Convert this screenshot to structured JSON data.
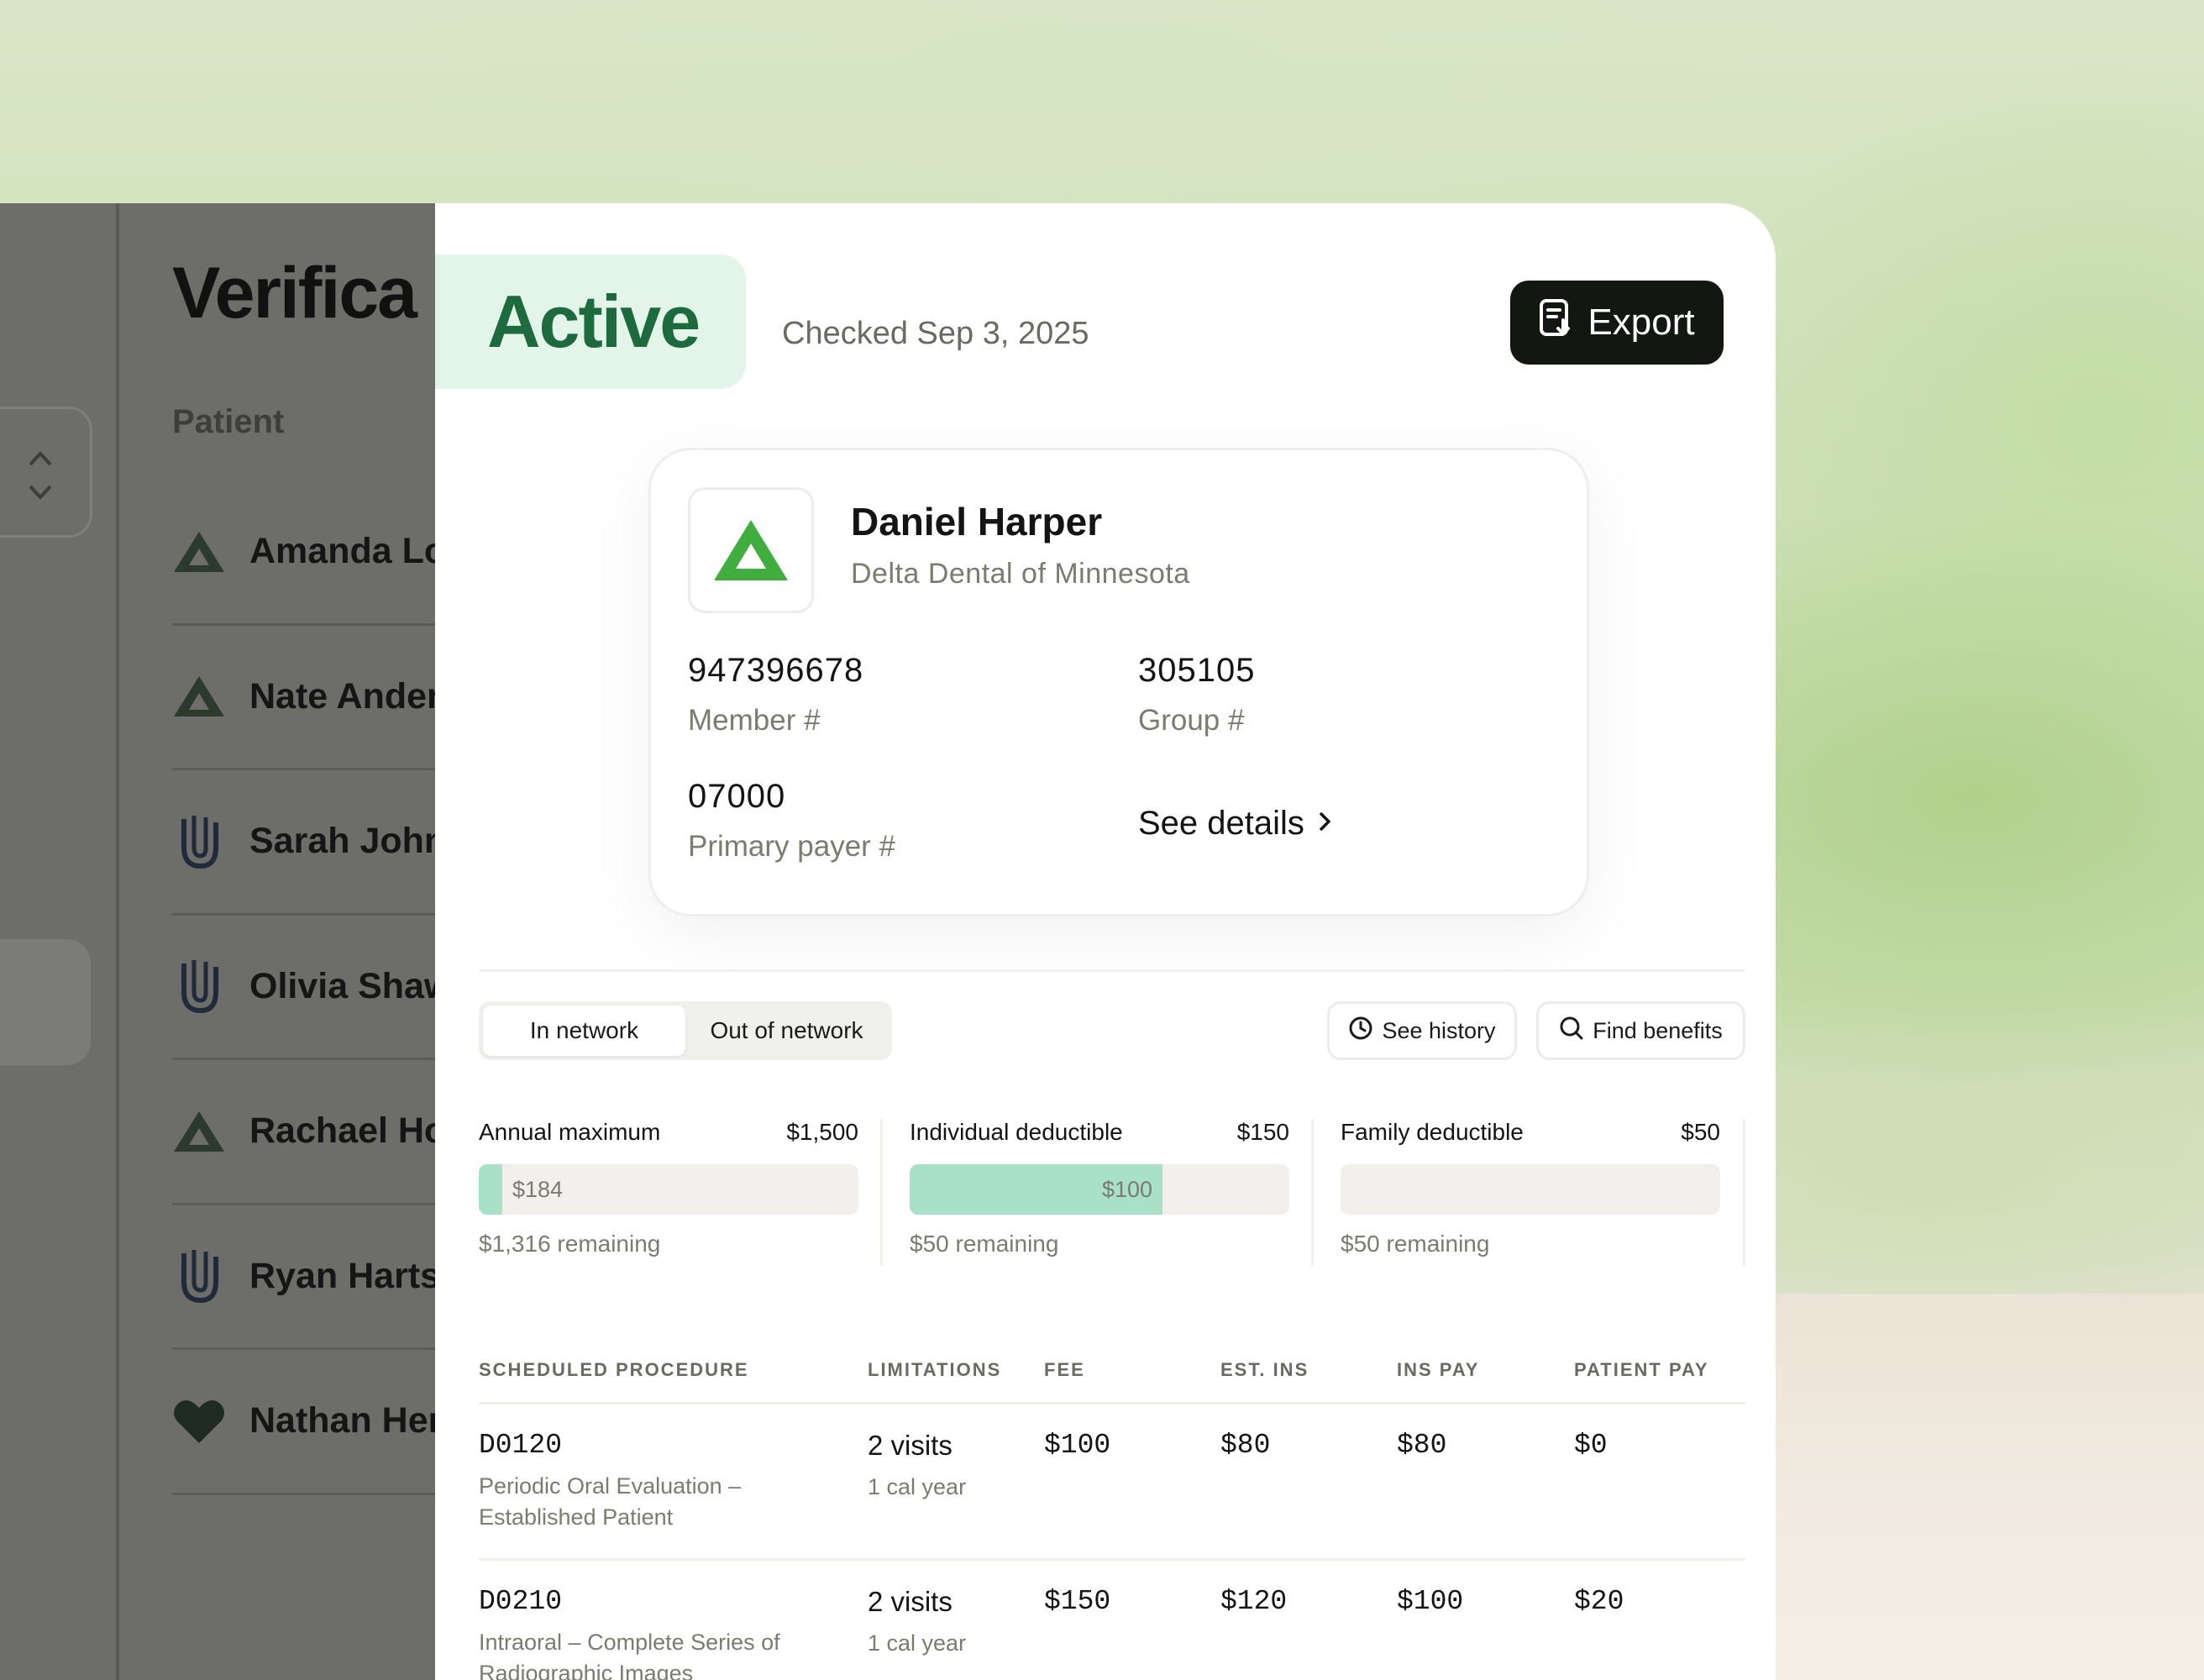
{
  "sidebar": {
    "title": "Verifica",
    "section_label": "Patient",
    "patients": [
      {
        "name": "Amanda Lo",
        "logo": "delta-dental-icon"
      },
      {
        "name": "Nate Ander",
        "logo": "delta-dental-icon"
      },
      {
        "name": "Sarah John",
        "logo": "unitedhealthcare-icon"
      },
      {
        "name": "Olivia Shaw",
        "logo": "unitedhealthcare-icon"
      },
      {
        "name": "Rachael Ho",
        "logo": "delta-dental-icon"
      },
      {
        "name": "Ryan Harts",
        "logo": "unitedhealthcare-icon"
      },
      {
        "name": "Nathan Her",
        "logo": "heart-icon"
      }
    ]
  },
  "header": {
    "status": "Active",
    "checked": "Checked Sep 3, 2025",
    "export_label": "Export"
  },
  "member_card": {
    "name": "Daniel Harper",
    "payer": "Delta Dental of Minnesota",
    "member_number": "947396678",
    "member_label": "Member #",
    "group_number": "305105",
    "group_label": "Group #",
    "primary_payer_number": "07000",
    "primary_payer_label": "Primary payer #",
    "details_link": "See details"
  },
  "network_tabs": [
    {
      "label": "In network",
      "active": true
    },
    {
      "label": "Out of network",
      "active": false
    }
  ],
  "actions": {
    "history_label": "See history",
    "benefits_label": "Find benefits"
  },
  "meters": [
    {
      "title": "Annual maximum",
      "max": "$1,500",
      "used": "$184",
      "used_fraction": 0.063,
      "remaining": "$1,316 remaining"
    },
    {
      "title": "Individual deductible",
      "max": "$150",
      "used": "$100",
      "used_fraction": 0.667,
      "remaining": "$50 remaining"
    },
    {
      "title": "Family deductible",
      "max": "$50",
      "used": "",
      "used_fraction": 0,
      "remaining": "$50 remaining"
    }
  ],
  "procedures": {
    "headers": [
      "SCHEDULED PROCEDURE",
      "LIMITATIONS",
      "FEE",
      "EST. INS",
      "INS PAY",
      "PATIENT PAY"
    ],
    "rows": [
      {
        "code": "D0120",
        "description": "Periodic Oral Evaluation – Established Patient",
        "limit": "2 visits",
        "limit_period": "1 cal year",
        "fee": "$100",
        "est_ins": "$80",
        "ins_pay": "$80",
        "patient_pay": "$0"
      },
      {
        "code": "D0210",
        "description": "Intraoral – Complete Series of Radiographic Images",
        "limit": "2 visits",
        "limit_period": "1 cal year",
        "fee": "$150",
        "est_ins": "$120",
        "ins_pay": "$100",
        "patient_pay": "$20"
      }
    ]
  },
  "colors": {
    "status_bg": "#e3f4e8",
    "status_text": "#1d6a3e",
    "meter_fill": "#a8e1c5",
    "delta_green": "#3fae3f",
    "export_bg": "#121712"
  }
}
